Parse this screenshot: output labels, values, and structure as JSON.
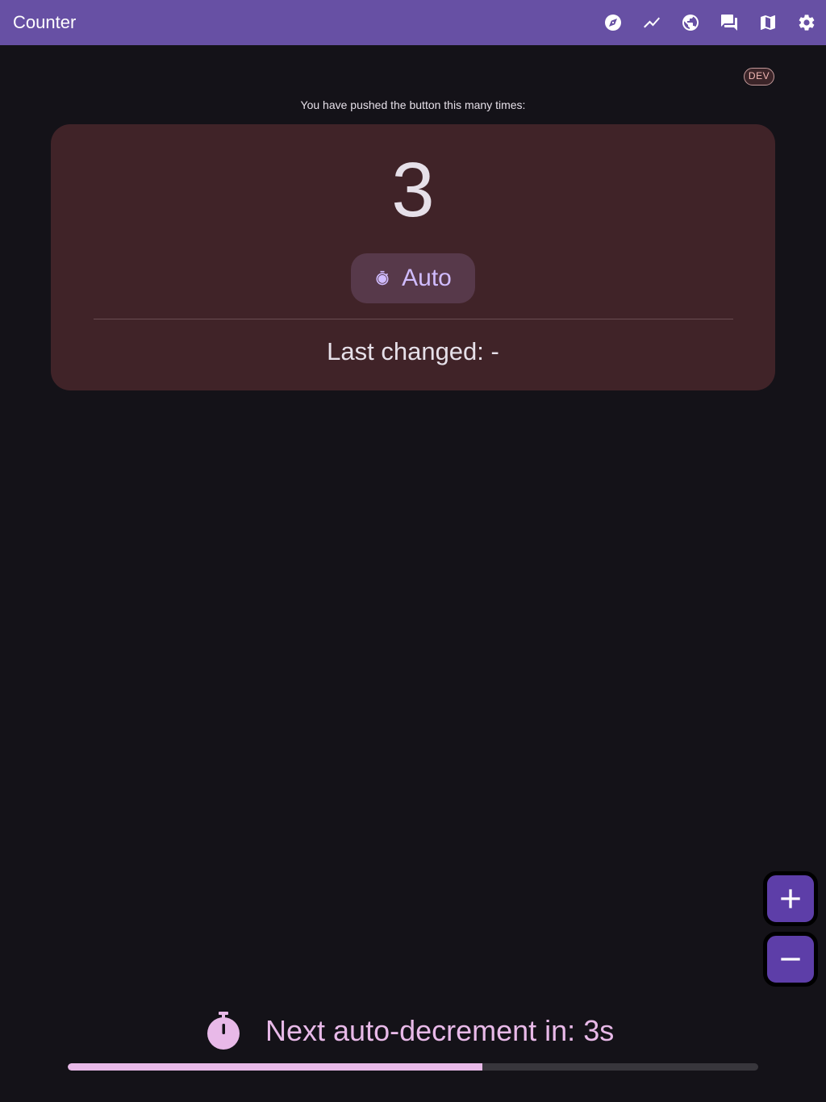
{
  "appbar": {
    "title": "Counter",
    "actions": [
      {
        "icon": "compass-icon"
      },
      {
        "icon": "trending-icon"
      },
      {
        "icon": "globe-icon"
      },
      {
        "icon": "chat-icon"
      },
      {
        "icon": "map-icon"
      },
      {
        "icon": "gear-icon"
      }
    ]
  },
  "dev_badge": "DEV",
  "caption": "You have pushed the button this many times:",
  "counter": {
    "value": "3",
    "mode_label": "Auto",
    "mode_icon": "timer-icon",
    "last_changed": "Last changed: -"
  },
  "fabs": {
    "increment_icon": "plus-icon",
    "decrement_icon": "minus-icon"
  },
  "auto_decrement": {
    "text": "Next auto-decrement in: 3s",
    "progress_fraction": 0.6
  },
  "colors": {
    "appbar": "#6750a4",
    "background": "#141218",
    "card": "#402328",
    "accent": "#d0bcff",
    "timer": "#e8b9e8",
    "fab": "#5d3ea8"
  }
}
